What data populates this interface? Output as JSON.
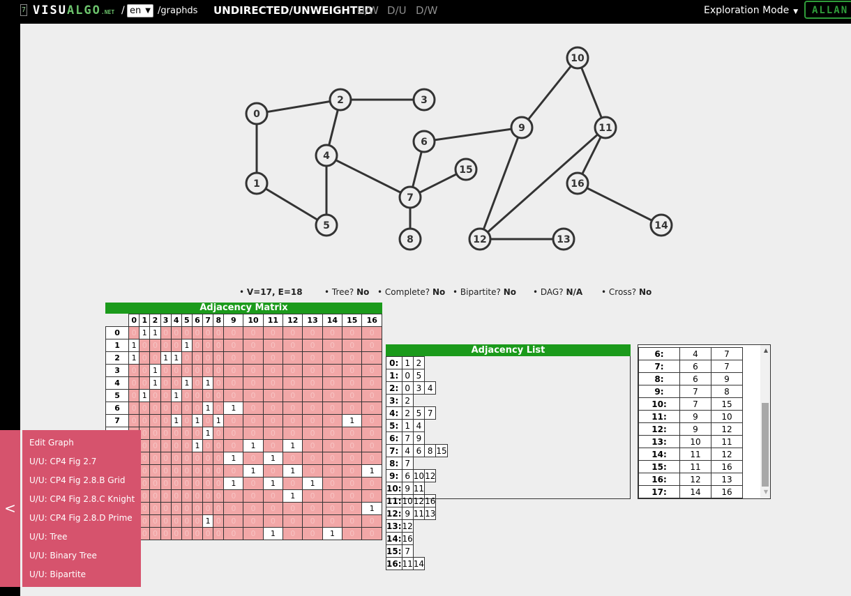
{
  "topbar": {
    "logo_prefix": "VISU",
    "logo_accent": "ALGO",
    "logo_suffix": ".NET",
    "slash": "/",
    "language": "en",
    "path": "/graphds",
    "active_mode": "UNDIRECTED/UNWEIGHTED",
    "mode_tabs": [
      "U/W",
      "D/U",
      "D/W"
    ],
    "exploration_mode": "Exploration Mode",
    "user_label": "ALLAN"
  },
  "graph": {
    "vertices": [
      "0",
      "1",
      "2",
      "3",
      "4",
      "5",
      "6",
      "7",
      "8",
      "9",
      "10",
      "11",
      "12",
      "13",
      "14",
      "15",
      "16"
    ],
    "edges": [
      [
        0,
        1
      ],
      [
        0,
        2
      ],
      [
        2,
        3
      ],
      [
        2,
        4
      ],
      [
        4,
        5
      ],
      [
        1,
        5
      ],
      [
        4,
        7
      ],
      [
        6,
        7
      ],
      [
        6,
        9
      ],
      [
        7,
        8
      ],
      [
        7,
        15
      ],
      [
        9,
        10
      ],
      [
        10,
        11
      ],
      [
        9,
        12
      ],
      [
        11,
        12
      ],
      [
        11,
        16
      ],
      [
        12,
        13
      ],
      [
        16,
        14
      ]
    ]
  },
  "stats": {
    "ve": "V=17, E=18",
    "tree_label": "Tree?",
    "tree_value": "No",
    "complete_label": "Complete?",
    "complete_value": "No",
    "bipartite_label": "Bipartite?",
    "bipartite_value": "No",
    "dag_label": "DAG?",
    "dag_value": "N/A",
    "cross_label": "Cross?",
    "cross_value": "No"
  },
  "adjacency_matrix": {
    "title": "Adjacency Matrix",
    "headers": [
      "0",
      "1",
      "2",
      "3",
      "4",
      "5",
      "6",
      "7",
      "8",
      "9",
      "10",
      "11",
      "12",
      "13",
      "14",
      "15",
      "16"
    ]
  },
  "adjacency_list": {
    "title": "Adjacency List",
    "rows": [
      {
        "key": "0:",
        "vals": [
          "1",
          "2"
        ]
      },
      {
        "key": "1:",
        "vals": [
          "0",
          "5"
        ]
      },
      {
        "key": "2:",
        "vals": [
          "0",
          "3",
          "4"
        ]
      },
      {
        "key": "3:",
        "vals": [
          "2"
        ]
      },
      {
        "key": "4:",
        "vals": [
          "2",
          "5",
          "7"
        ]
      },
      {
        "key": "5:",
        "vals": [
          "1",
          "4"
        ]
      },
      {
        "key": "6:",
        "vals": [
          "7",
          "9"
        ]
      },
      {
        "key": "7:",
        "vals": [
          "4",
          "6",
          "8",
          "15"
        ]
      },
      {
        "key": "8:",
        "vals": [
          "7"
        ]
      },
      {
        "key": "9:",
        "vals": [
          "6",
          "10",
          "12"
        ]
      },
      {
        "key": "10:",
        "vals": [
          "9",
          "11"
        ]
      },
      {
        "key": "11:",
        "vals": [
          "10",
          "12",
          "16"
        ]
      },
      {
        "key": "12:",
        "vals": [
          "9",
          "11",
          "13"
        ]
      },
      {
        "key": "13:",
        "vals": [
          "12"
        ]
      },
      {
        "key": "14:",
        "vals": [
          "16"
        ]
      },
      {
        "key": "15:",
        "vals": [
          "7"
        ]
      },
      {
        "key": "16:",
        "vals": [
          "11",
          "14"
        ]
      }
    ]
  },
  "scroll_list": {
    "rows": [
      {
        "key": "6:",
        "vals": [
          "4",
          "7"
        ]
      },
      {
        "key": "7:",
        "vals": [
          "6",
          "7"
        ]
      },
      {
        "key": "8:",
        "vals": [
          "6",
          "9"
        ]
      },
      {
        "key": "9:",
        "vals": [
          "7",
          "8"
        ]
      },
      {
        "key": "10:",
        "vals": [
          "7",
          "15"
        ]
      },
      {
        "key": "11:",
        "vals": [
          "9",
          "10"
        ]
      },
      {
        "key": "12:",
        "vals": [
          "9",
          "12"
        ]
      },
      {
        "key": "13:",
        "vals": [
          "10",
          "11"
        ]
      },
      {
        "key": "14:",
        "vals": [
          "11",
          "12"
        ]
      },
      {
        "key": "15:",
        "vals": [
          "11",
          "16"
        ]
      },
      {
        "key": "16:",
        "vals": [
          "12",
          "13"
        ]
      },
      {
        "key": "17:",
        "vals": [
          "14",
          "16"
        ]
      }
    ]
  },
  "examples": {
    "toggle": "<",
    "items": [
      "Edit Graph",
      "U/U: CP4 Fig 2.7",
      "U/U: CP4 Fig 2.8.B Grid",
      "U/U: CP4 Fig 2.8.C Knight",
      "U/U: CP4 Fig 2.8.D Prime",
      "U/U: Tree",
      "U/U: Binary Tree",
      "U/U: Bipartite"
    ]
  },
  "colors": {
    "header_green": "#1b9a1b",
    "matrix_zero": "#f2a7a7",
    "menu_pink": "#d6536d"
  }
}
